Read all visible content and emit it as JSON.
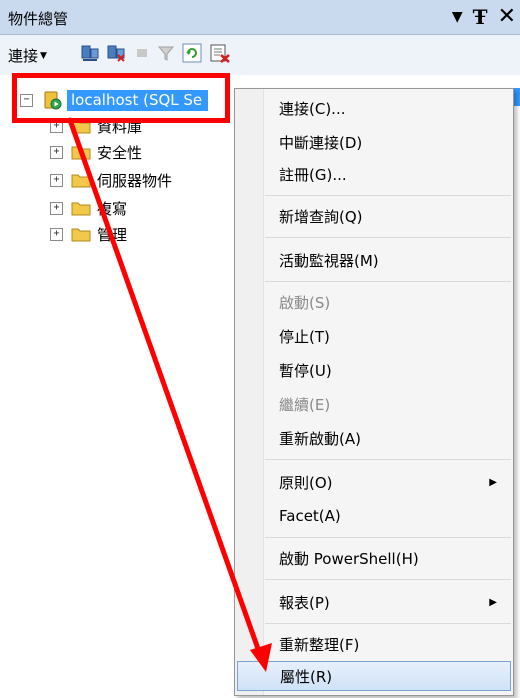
{
  "window": {
    "title": "物件總管"
  },
  "toolbar": {
    "connect_label": "連接"
  },
  "tree": {
    "root_label": "localhost (SQL Se",
    "children": [
      "資料庫",
      "安全性",
      "伺服器物件",
      "複寫",
      "管理"
    ]
  },
  "menu": {
    "items": [
      {
        "label": "連接(C)..."
      },
      {
        "label": "中斷連接(D)"
      },
      {
        "label": "註冊(G)..."
      },
      {
        "label": "新增查詢(Q)"
      },
      {
        "label": "活動監視器(M)"
      },
      {
        "label": "啟動(S)"
      },
      {
        "label": "停止(T)"
      },
      {
        "label": "暫停(U)"
      },
      {
        "label": "繼續(E)"
      },
      {
        "label": "重新啟動(A)"
      },
      {
        "label": "原則(O)"
      },
      {
        "label": "Facet(A)"
      },
      {
        "label": "啟動 PowerShell(H)"
      },
      {
        "label": "報表(P)"
      },
      {
        "label": "重新整理(F)"
      },
      {
        "label": "屬性(R)"
      }
    ]
  },
  "colors": {
    "selection": "#3399ff",
    "annotation": "#ff0000"
  }
}
